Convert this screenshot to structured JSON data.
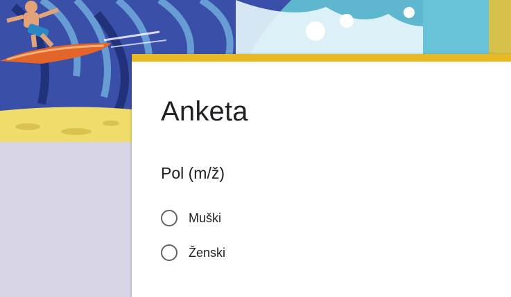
{
  "form": {
    "title": "Anketa",
    "header_image": "surfer-on-wave-illustration",
    "accent_color": "#e8b923",
    "background_color": "#d7d5e6"
  },
  "question": {
    "label": "Pol (m/ž)",
    "options": [
      {
        "label": "Muški",
        "selected": false
      },
      {
        "label": "Ženski",
        "selected": false
      }
    ]
  }
}
